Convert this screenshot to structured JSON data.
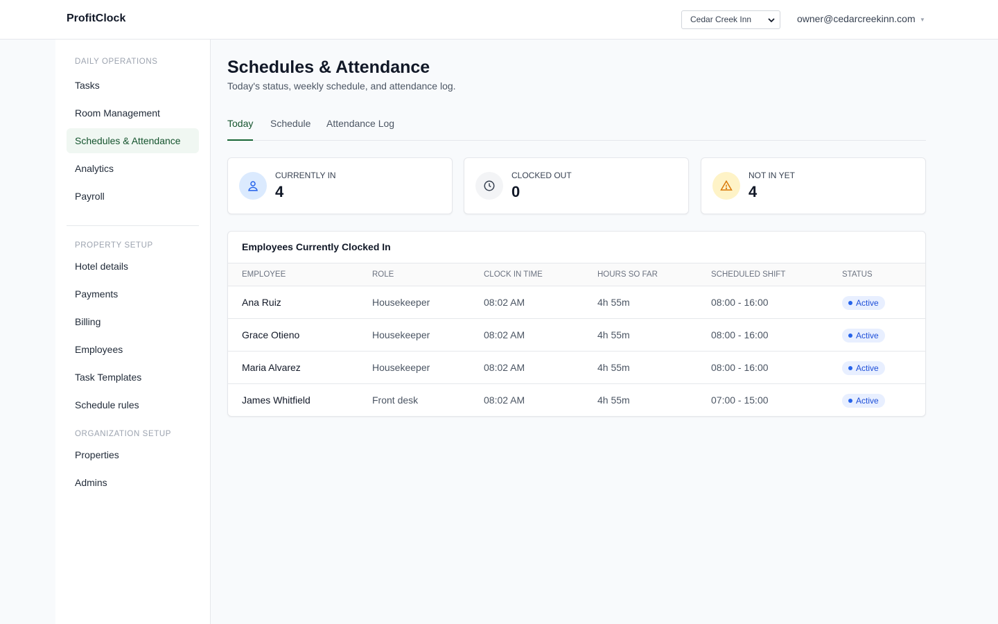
{
  "app": {
    "brand": "ProfitClock"
  },
  "header": {
    "property_selected": "Cedar Creek Inn",
    "user_email": "owner@cedarcreekinn.com"
  },
  "sidebar": {
    "sections": [
      {
        "title": "Daily Operations",
        "items": [
          "Tasks",
          "Room Management",
          "Schedules & Attendance",
          "Analytics",
          "Payroll"
        ]
      },
      {
        "title": "Property Setup",
        "items": [
          "Hotel details",
          "Payments",
          "Billing",
          "Employees",
          "Task Templates",
          "Schedule rules"
        ]
      },
      {
        "title": "Organization Setup",
        "items": [
          "Properties",
          "Admins"
        ]
      }
    ],
    "active_item": "Schedules & Attendance"
  },
  "page": {
    "title": "Schedules & Attendance",
    "subtitle": "Today's status, weekly schedule, and attendance log.",
    "tabs": [
      "Today",
      "Schedule",
      "Attendance Log"
    ],
    "active_tab": "Today"
  },
  "stats": [
    {
      "label": "Currently In",
      "value": "4",
      "icon": "user-icon",
      "color": "#dbeafe"
    },
    {
      "label": "Clocked Out",
      "value": "0",
      "icon": "clock-icon",
      "color": "#f3f4f6"
    },
    {
      "label": "Not In Yet",
      "value": "4",
      "icon": "warning-icon",
      "color": "#fef3c7"
    }
  ],
  "table": {
    "title": "Employees Currently Clocked In",
    "columns": [
      "Employee",
      "Role",
      "Clock In Time",
      "Hours So Far",
      "Scheduled Shift",
      "Status"
    ],
    "rows": [
      {
        "employee": "Ana Ruiz",
        "role": "Housekeeper",
        "clock_in": "08:02 AM",
        "hours": "4h 55m",
        "shift": "08:00 - 16:00",
        "status": "Active"
      },
      {
        "employee": "Grace Otieno",
        "role": "Housekeeper",
        "clock_in": "08:02 AM",
        "hours": "4h 55m",
        "shift": "08:00 - 16:00",
        "status": "Active"
      },
      {
        "employee": "Maria Alvarez",
        "role": "Housekeeper",
        "clock_in": "08:02 AM",
        "hours": "4h 55m",
        "shift": "08:00 - 16:00",
        "status": "Active"
      },
      {
        "employee": "James Whitfield",
        "role": "Front desk",
        "clock_in": "08:02 AM",
        "hours": "4h 55m",
        "shift": "07:00 - 15:00",
        "status": "Active"
      }
    ]
  },
  "colors": {
    "accent": "#166534",
    "active_nav_bg": "#f0f7f2",
    "badge_bg": "#e8efff",
    "badge_text": "#1d4ed8"
  }
}
